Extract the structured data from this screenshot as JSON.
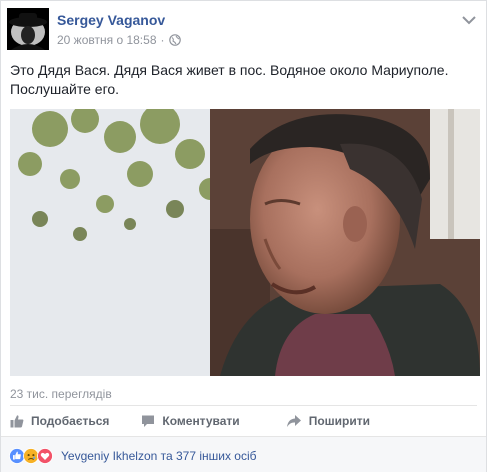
{
  "post": {
    "author": "Sergey Vaganov",
    "timestamp": "20 жовтня о 18:58",
    "separator": "·",
    "privacy_icon": "globe-icon",
    "menu_icon": "chevron-down-icon",
    "text": "Это Дядя Вася. Дядя Вася живет в пос. Водяное около Мариуполе. Послушайте его."
  },
  "video": {
    "views": "23 тис. переглядів"
  },
  "actions": {
    "like": "Подобається",
    "comment": "Коментувати",
    "share": "Поширити"
  },
  "reactions": {
    "icons": [
      "like-reaction-icon",
      "sad-reaction-icon",
      "love-reaction-icon"
    ],
    "summary": "Yevgeniy Ikhelzon та 377 інших осіб"
  },
  "colors": {
    "link": "#365899",
    "muted": "#90949c",
    "like_blue": "#5890ff",
    "sad_yellow": "#f7b125",
    "love_red": "#f25268"
  }
}
